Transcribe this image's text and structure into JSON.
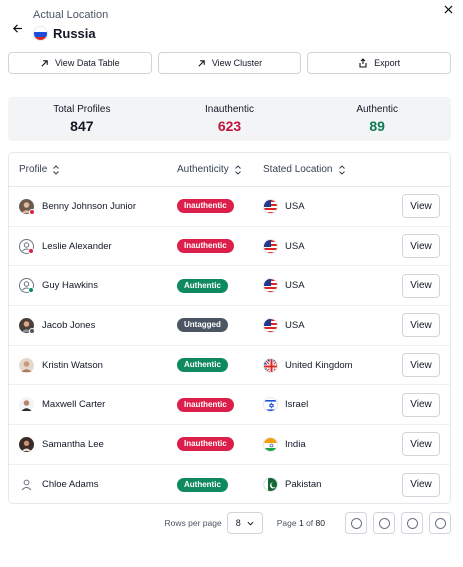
{
  "header": {
    "subtitle": "Actual Location",
    "country": "Russia"
  },
  "toolbar": {
    "view_data_table": "View Data Table",
    "view_cluster": "View Cluster",
    "export": "Export"
  },
  "stats": {
    "total_label": "Total Profiles",
    "total_value": "847",
    "inauthentic_label": "Inauthentic",
    "inauthentic_value": "623",
    "authentic_label": "Authentic",
    "authentic_value": "89"
  },
  "table": {
    "columns": {
      "profile": "Profile",
      "authenticity": "Authenticity",
      "location": "Stated Location"
    },
    "view_label": "View",
    "rows": [
      {
        "name": "Benny Johnson Junior",
        "status": "Inauthentic",
        "location": "USA"
      },
      {
        "name": "Leslie Alexander",
        "status": "Inauthentic",
        "location": "USA"
      },
      {
        "name": "Guy Hawkins",
        "status": "Authentic",
        "location": "USA"
      },
      {
        "name": "Jacob Jones",
        "status": "Untagged",
        "location": "USA"
      },
      {
        "name": "Kristin Watson",
        "status": "Authentic",
        "location": "United Kingdom"
      },
      {
        "name": "Maxwell Carter",
        "status": "Inauthentic",
        "location": "Israel"
      },
      {
        "name": "Samantha Lee",
        "status": "Inauthentic",
        "location": "India"
      },
      {
        "name": "Chloe Adams",
        "status": "Authentic",
        "location": "Pakistan"
      }
    ]
  },
  "pagination": {
    "rows_per_page_label": "Rows per page",
    "rows_per_page_value": "8",
    "page_prefix": "Page",
    "page_current": "1",
    "page_of": "of",
    "page_total": "80"
  },
  "colors": {
    "inauthentic": "#dc1e4a",
    "authentic": "#0f8a5f",
    "untagged": "#4b5563"
  }
}
